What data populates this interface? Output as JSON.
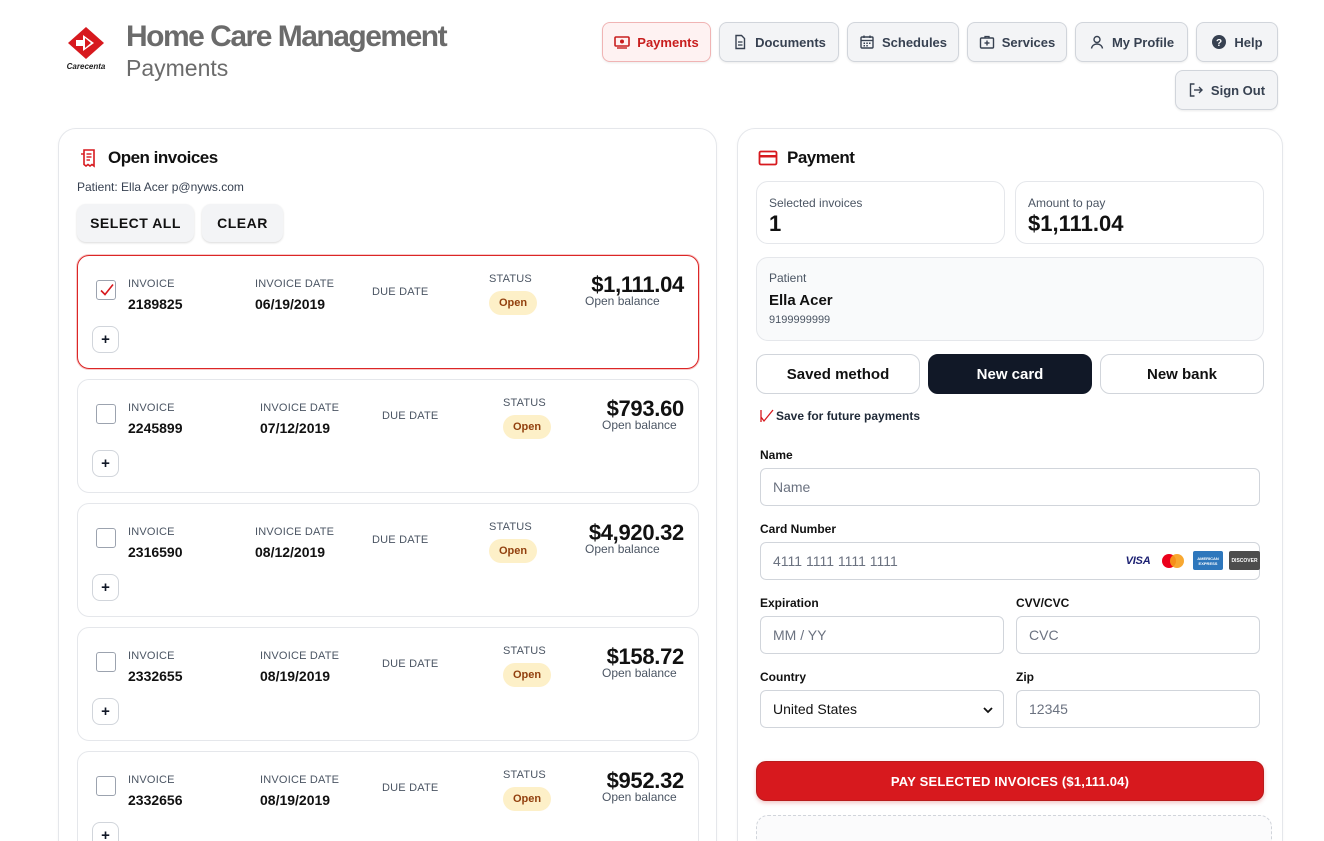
{
  "brand": {
    "logo_text": "Carecenta",
    "title": "Home Care Management",
    "subtitle": "Payments",
    "accent": "#d7191e"
  },
  "nav": {
    "payments": "Payments",
    "documents": "Documents",
    "schedules": "Schedules",
    "services": "Services",
    "my_profile": "My Profile",
    "help": "Help",
    "sign_out": "Sign Out"
  },
  "invoices_panel": {
    "title": "Open invoices",
    "patient_line": "Patient: Ella Acer p@nyws.com",
    "select_all": "SELECT ALL",
    "clear": "CLEAR",
    "labels": {
      "invoice": "INVOICE",
      "invoice_date": "INVOICE DATE",
      "due_date": "DUE DATE",
      "status": "STATUS",
      "open_balance": "Open balance",
      "expand": "+"
    },
    "invoices": [
      {
        "number": "2189825",
        "date": "06/19/2019",
        "status": "Open",
        "amount": "$1,111.04",
        "selected": true
      },
      {
        "number": "2245899",
        "date": "07/12/2019",
        "status": "Open",
        "amount": "$793.60",
        "selected": false
      },
      {
        "number": "2316590",
        "date": "08/12/2019",
        "status": "Open",
        "amount": "$4,920.32",
        "selected": false
      },
      {
        "number": "2332655",
        "date": "08/19/2019",
        "status": "Open",
        "amount": "$158.72",
        "selected": false
      },
      {
        "number": "2332656",
        "date": "08/19/2019",
        "status": "Open",
        "amount": "$952.32",
        "selected": false
      }
    ]
  },
  "payment_panel": {
    "title": "Payment",
    "selected_invoices_label": "Selected invoices",
    "selected_invoices_value": "1",
    "amount_label": "Amount to pay",
    "amount_value": "$1,111.04",
    "patient_label": "Patient",
    "patient_name": "Ella Acer",
    "patient_phone": "9199999999",
    "methods": {
      "saved": "Saved method",
      "new_card": "New card",
      "new_bank": "New bank",
      "active": "new_card"
    },
    "save_future": "Save for future payments",
    "fields": {
      "name_label": "Name",
      "name_placeholder": "Name",
      "card_label": "Card Number",
      "card_placeholder": "4111 1111 1111 1111",
      "exp_label": "Expiration",
      "exp_placeholder": "MM / YY",
      "cvv_label": "CVV/CVC",
      "cvv_placeholder": "CVC",
      "country_label": "Country",
      "country_value": "United States",
      "zip_label": "Zip",
      "zip_placeholder": "12345"
    },
    "card_brands": {
      "visa": "VISA",
      "amex": "AMERICAN EXPRESS",
      "discover": "DISCOVER"
    },
    "pay_button": "PAY SELECTED INVOICES ($1,111.04)"
  }
}
